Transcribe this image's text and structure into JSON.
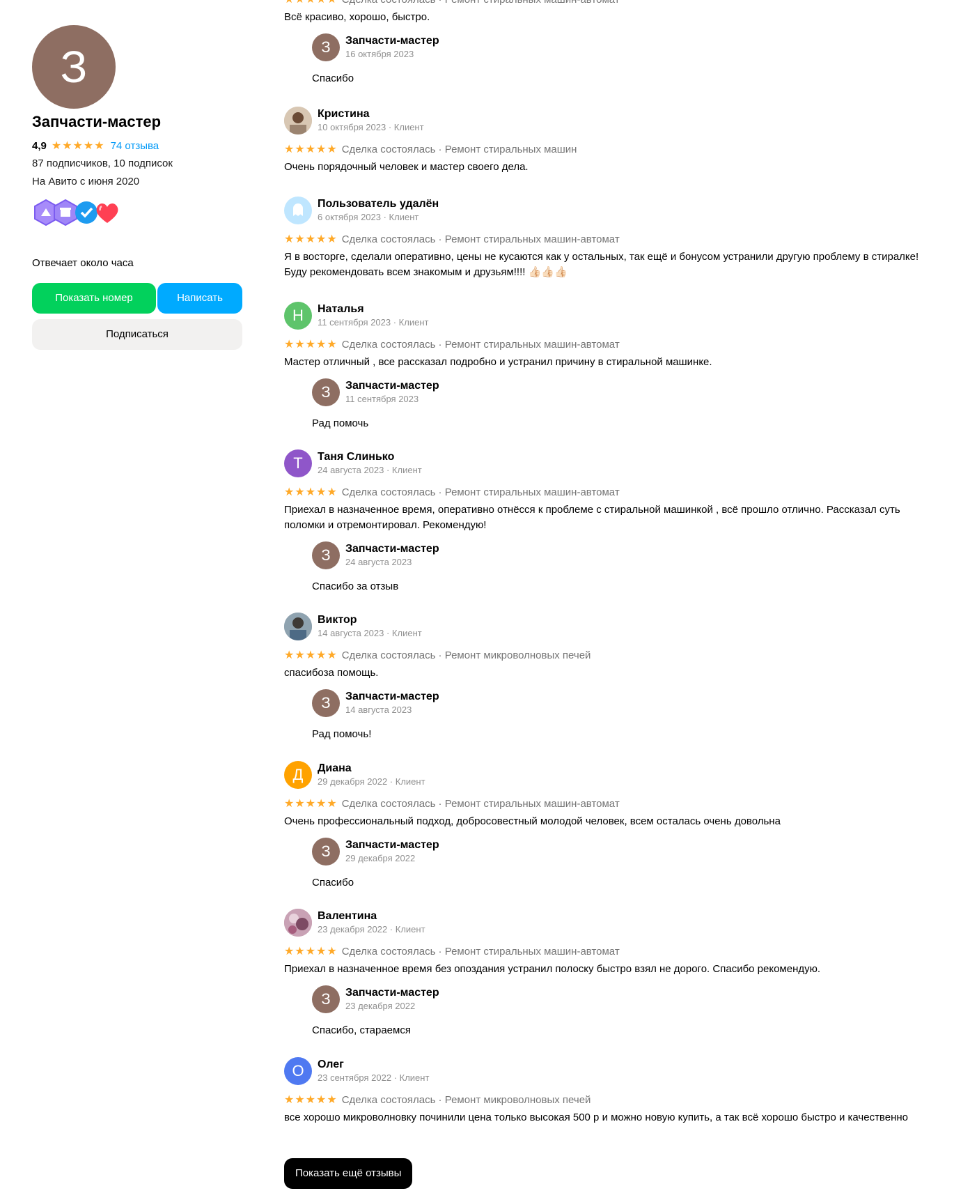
{
  "seller": {
    "avatar_letter": "З",
    "name": "Запчасти-мастер",
    "rating": "4,9",
    "stars": "★★★★★",
    "reviews_link": "74 отзыва",
    "followers": "87 подписчиков, 10 подписок",
    "since": "На Авито с июня 2020",
    "responds": "Отвечает около часа",
    "badges": [
      "reliable-seller-badge",
      "shop-badge",
      "verified-badge",
      "heart-badge"
    ],
    "accent": "#8e6e62"
  },
  "buttons": {
    "show_phone": "Показать номер",
    "write": "Написать",
    "subscribe": "Подписаться",
    "show_more": "Показать ещё отзывы"
  },
  "colors": {
    "green": "#02d15c",
    "blue": "#00aaff",
    "star": "#ffa928",
    "link": "#0099f7"
  },
  "reviews": [
    {
      "stars": "★★★★★",
      "meta": "Сделка состоялась · Ремонт стиральных машин-автомат",
      "text": "Всё красиво, хорошо, быстро.",
      "reply": {
        "name": "Запчасти-мастер",
        "date": "16 октября 2023",
        "text": "Спасибо"
      }
    },
    {
      "name": "Кристина",
      "date": "10 октября 2023 · Клиент",
      "avatar": "photo",
      "stars": "★★★★★",
      "meta": "Сделка состоялась · Ремонт стиральных машин",
      "text": "Очень порядочный человек и мастер своего дела."
    },
    {
      "name": "Пользователь удалён",
      "date": "6 октября 2023 · Клиент",
      "avatar": "ghost-icon",
      "stars": "★★★★★",
      "meta": "Сделка состоялась · Ремонт стиральных машин-автомат",
      "text": "Я в восторге, сделали оперативно, цены не кусаются как у остальных, так ещё и бонусом устранили другую проблему в стиралке! Буду рекомендовать всем знакомым и друзьям!!!! 👍🏻👍🏻👍🏻"
    },
    {
      "name": "Наталья",
      "date": "11 сентября 2023 · Клиент",
      "avatar_letter": "Н",
      "avatar_color": "#5ec46b",
      "stars": "★★★★★",
      "meta": "Сделка состоялась · Ремонт стиральных машин-автомат",
      "text": "Мастер отличный , все рассказал подробно и устранил причину в стиральной машинке.",
      "reply": {
        "name": "Запчасти-мастер",
        "date": "11 сентября 2023",
        "text": "Рад помочь"
      }
    },
    {
      "name": "Таня Слинько",
      "date": "24 августа 2023 · Клиент",
      "avatar_letter": "Т",
      "avatar_color": "#8f56c9",
      "stars": "★★★★★",
      "meta": "Сделка состоялась · Ремонт стиральных машин-автомат",
      "text": "Приехал в назначенное время, оперативно отнёсся к проблеме с стиральной машинкой , всё прошло отлично. Рассказал суть поломки и отремонтировал. Рекомендую!",
      "reply": {
        "name": "Запчасти-мастер",
        "date": "24 августа 2023",
        "text": "Спасибо за отзыв"
      }
    },
    {
      "name": "Виктор",
      "date": "14 августа 2023 · Клиент",
      "avatar": "photo",
      "stars": "★★★★★",
      "meta": "Сделка состоялась · Ремонт микроволновых печей",
      "text": "спасибоза помощь.",
      "reply": {
        "name": "Запчасти-мастер",
        "date": "14 августа 2023",
        "text": "Рад помочь!"
      }
    },
    {
      "name": "Диана",
      "date": "29 декабря 2022 · Клиент",
      "avatar_letter": "Д",
      "avatar_color": "#ffa200",
      "stars": "★★★★★",
      "meta": "Сделка состоялась · Ремонт стиральных машин-автомат",
      "text": "Очень профессиональный подход, добросовестный молодой человек, всем осталась очень довольна",
      "reply": {
        "name": "Запчасти-мастер",
        "date": "29 декабря 2022",
        "text": "Спасибо"
      }
    },
    {
      "name": "Валентина",
      "date": "23 декабря 2022 · Клиент",
      "avatar": "photo",
      "stars": "★★★★★",
      "meta": "Сделка состоялась · Ремонт стиральных машин-автомат",
      "text": "Приехал в назначенное время без опоздания устранил полоску быстро взял не дорого. Спасибо рекомендую.",
      "reply": {
        "name": "Запчасти-мастер",
        "date": "23 декабря 2022",
        "text": "Спасибо, стараемся"
      }
    },
    {
      "name": "Олег",
      "date": "23 сентября 2022 · Клиент",
      "avatar_letter": "О",
      "avatar_color": "#4f79f1",
      "stars": "★★★★★",
      "meta": "Сделка состоялась · Ремонт микроволновых печей",
      "text": "все хорошо микроволновку починили цена только высокая 500 р и можно новую купить, а так всё хорошо быстро и качественно"
    }
  ]
}
